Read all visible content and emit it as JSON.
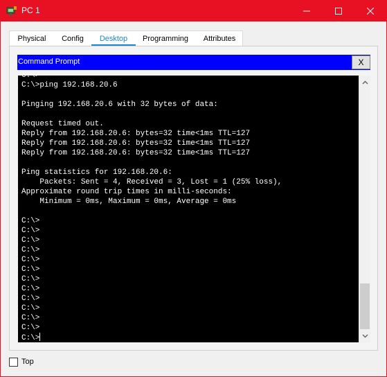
{
  "window": {
    "title": "PC 1",
    "accent_color": "#e81123"
  },
  "tabs": [
    {
      "label": "Physical"
    },
    {
      "label": "Config"
    },
    {
      "label": "Desktop",
      "active": true
    },
    {
      "label": "Programming"
    },
    {
      "label": "Attributes"
    }
  ],
  "command_prompt": {
    "title": "Command Prompt",
    "close_label": "X",
    "title_color": "#0000ff",
    "lines": [
      "C:\\>",
      "C:\\>ping 192.168.20.6",
      "",
      "Pinging 192.168.20.6 with 32 bytes of data:",
      "",
      "Request timed out.",
      "Reply from 192.168.20.6: bytes=32 time<1ms TTL=127",
      "Reply from 192.168.20.6: bytes=32 time<1ms TTL=127",
      "Reply from 192.168.20.6: bytes=32 time<1ms TTL=127",
      "",
      "Ping statistics for 192.168.20.6:",
      "    Packets: Sent = 4, Received = 3, Lost = 1 (25% loss),",
      "Approximate round trip times in milli-seconds:",
      "    Minimum = 0ms, Maximum = 0ms, Average = 0ms",
      "",
      "C:\\>",
      "C:\\>",
      "C:\\>",
      "C:\\>",
      "C:\\>",
      "C:\\>",
      "C:\\>",
      "C:\\>",
      "C:\\>",
      "C:\\>",
      "C:\\>",
      "C:\\>",
      "C:\\>"
    ]
  },
  "footer": {
    "top_label": "Top",
    "top_checked": false
  }
}
